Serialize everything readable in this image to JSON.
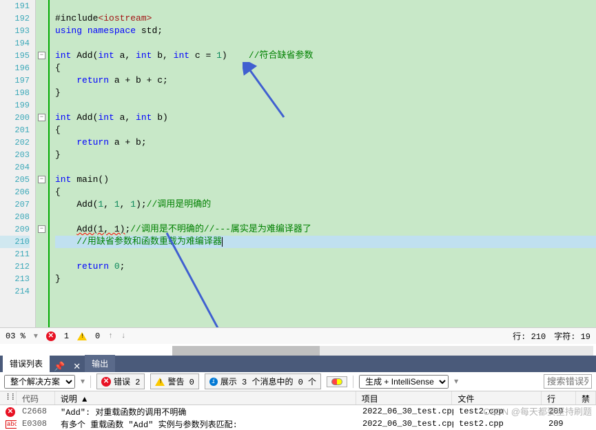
{
  "gutter": {
    "start": 191,
    "end": 214
  },
  "code": {
    "192": [
      [
        "",
        "#include"
      ],
      [
        "inc",
        "<iostream>"
      ]
    ],
    "193": [
      [
        "kw",
        "using"
      ],
      [
        "",
        " "
      ],
      [
        "kw",
        "namespace"
      ],
      [
        "",
        " std;"
      ]
    ],
    "195": [
      [
        "kw",
        "int"
      ],
      [
        "",
        " Add("
      ],
      [
        "kw",
        "int"
      ],
      [
        "",
        " a, "
      ],
      [
        "kw",
        "int"
      ],
      [
        "",
        " b, "
      ],
      [
        "kw",
        "int"
      ],
      [
        "",
        " c = "
      ],
      [
        "num",
        "1"
      ],
      [
        "",
        ")    "
      ],
      [
        "cm",
        "//符合缺省参数"
      ]
    ],
    "196": [
      [
        "",
        "{"
      ]
    ],
    "197": [
      [
        "",
        "    "
      ],
      [
        "kw",
        "return"
      ],
      [
        "",
        " a + b + c;"
      ]
    ],
    "198": [
      [
        "",
        "}"
      ]
    ],
    "200": [
      [
        "kw",
        "int"
      ],
      [
        "",
        " Add("
      ],
      [
        "kw",
        "int"
      ],
      [
        "",
        " a, "
      ],
      [
        "kw",
        "int"
      ],
      [
        "",
        " b)"
      ]
    ],
    "201": [
      [
        "",
        "{"
      ]
    ],
    "202": [
      [
        "",
        "    "
      ],
      [
        "kw",
        "return"
      ],
      [
        "",
        " a + b;"
      ]
    ],
    "203": [
      [
        "",
        "}"
      ]
    ],
    "205": [
      [
        "kw",
        "int"
      ],
      [
        "",
        " main()"
      ]
    ],
    "206": [
      [
        "",
        "{"
      ]
    ],
    "207": [
      [
        "",
        "    Add("
      ],
      [
        "num",
        "1"
      ],
      [
        "",
        ", "
      ],
      [
        "num",
        "1"
      ],
      [
        "",
        ", "
      ],
      [
        "num",
        "1"
      ],
      [
        "",
        ");"
      ],
      [
        "cm",
        "//调用是明确的"
      ]
    ],
    "209": [
      [
        "",
        "    "
      ],
      [
        "wavy",
        "Add(1, 1)"
      ],
      [
        "",
        ";"
      ],
      [
        "cm",
        "//调用是不明确的//---属实是为难编译器了"
      ]
    ],
    "210": [
      [
        "",
        "    "
      ],
      [
        "cm",
        "//用缺省参数和函数重载为难编译器"
      ]
    ],
    "212": [
      [
        "",
        "    "
      ],
      [
        "kw",
        "return"
      ],
      [
        "",
        " "
      ],
      [
        "num",
        "0"
      ],
      [
        "",
        ";"
      ]
    ],
    "213": [
      [
        "",
        "}"
      ]
    ]
  },
  "fold": {
    "195": "-",
    "200": "-",
    "205": "-",
    "209": "-"
  },
  "status": {
    "zoom": "03 %",
    "errors": "1",
    "warnings": "0",
    "line_label": "行: 210",
    "char_label": "字符: 19"
  },
  "panel": {
    "tab_errorlist": "错误列表",
    "tab_output": "输出"
  },
  "filter": {
    "scope": "整个解决方案",
    "errors_label": "错误 2",
    "warnings_label": "警告 0",
    "messages_label": "展示 3 个消息中的 0 个",
    "build_source": "生成 + IntelliSense",
    "search_placeholder": "搜索错误列"
  },
  "grid": {
    "headers": {
      "code": "代码",
      "desc": "说明 ▲",
      "proj": "项目",
      "file": "文件",
      "line": "行",
      "suppress": "禁"
    },
    "rows": [
      {
        "icon": "error",
        "code": "C2668",
        "desc": "\"Add\": 对重载函数的调用不明确",
        "proj": "2022_06_30_test.cpp",
        "file": "test2.cpp",
        "line": "209"
      },
      {
        "icon": "abc",
        "code": "E0308",
        "desc": "有多个 重载函数 \"Add\" 实例与参数列表匹配:",
        "proj": "2022_06_30_test.cpp",
        "file": "test2.cpp",
        "line": "209"
      }
    ]
  },
  "watermark": "CSDN @每天都要坚持刷题"
}
